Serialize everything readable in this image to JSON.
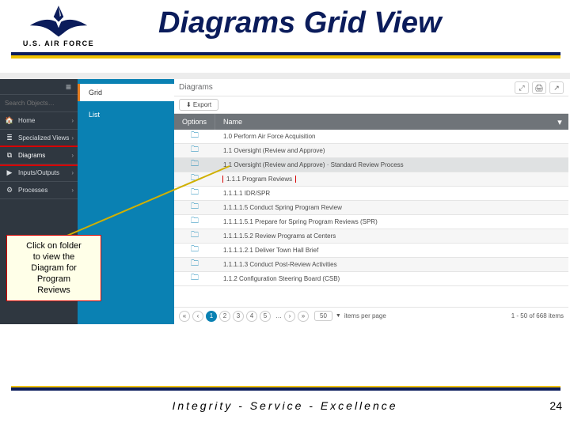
{
  "header": {
    "org": "U.S. AIR FORCE",
    "title": "Diagrams Grid View"
  },
  "sidebar": {
    "search_placeholder": "Search Objects…",
    "items": [
      {
        "icon": "home-icon",
        "glyph": "🏠",
        "label": "Home"
      },
      {
        "icon": "views-icon",
        "glyph": "≣",
        "label": "Specialized Views"
      },
      {
        "icon": "diagram-icon",
        "glyph": "⧉",
        "label": "Diagrams"
      },
      {
        "icon": "io-icon",
        "glyph": "▶",
        "label": "Inputs/Outputs"
      },
      {
        "icon": "process-icon",
        "glyph": "⚙",
        "label": "Processes"
      }
    ]
  },
  "viewswitch": {
    "items": [
      {
        "label": "Grid",
        "active": true
      },
      {
        "label": "List",
        "active": false
      }
    ]
  },
  "main": {
    "breadcrumb": "Diagrams",
    "export_label": "⬇ Export",
    "columns": {
      "options": "Options",
      "name": "Name"
    },
    "rows": [
      {
        "name": "1.0 Perform Air Force Acquisition"
      },
      {
        "name": "1.1 Oversight (Review and Approve)"
      },
      {
        "name": "1.1 Oversight (Review and Approve) · Standard Review Process",
        "shade": true
      },
      {
        "name": "1.1.1 Program Reviews",
        "hl": true
      },
      {
        "name": "1.1.1.1 IDR/SPR"
      },
      {
        "name": "1.1.1.1.5 Conduct Spring Program Review"
      },
      {
        "name": "1.1.1.1.5.1 Prepare for Spring Program Reviews (SPR)"
      },
      {
        "name": "1.1.1.1.5.2 Review Programs at Centers"
      },
      {
        "name": "1.1.1.1.2.1 Deliver Town Hall Brief"
      },
      {
        "name": "1.1.1.1.3 Conduct Post-Review Activities"
      },
      {
        "name": "1.1.2 Configuration Steering Board (CSB)"
      }
    ],
    "pager": {
      "pages": [
        "1",
        "2",
        "3",
        "4",
        "5"
      ],
      "page_size": "50",
      "size_label": "items per page",
      "status": "1 - 50 of 668 items"
    }
  },
  "callout": {
    "l1": "Click on folder",
    "l2": "to view the",
    "l3": "Diagram for",
    "l4": "Program",
    "l5": "Reviews"
  },
  "footer": {
    "tagline": "Integrity - Service - Excellence",
    "page": "24"
  }
}
